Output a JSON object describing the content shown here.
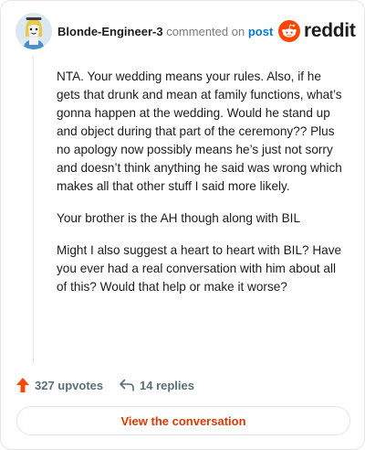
{
  "comment": {
    "author": "Blonde-Engineer-3",
    "action_text": "commented on",
    "post_link": "post",
    "paragraphs": [
      "NTA. Your wedding means your rules. Also, if he gets that drunk and mean at family functions, what’s gonna happen at the wedding. Would he stand up and object during that part of the ceremony?? Plus no apology now possibly means he’s just not sorry and doesn’t think anything he said was wrong which makes all that other stuff I said more likely.",
      "Your brother is the AH though along with BIL",
      "Might I also suggest a heart to heart with BIL? Have you ever had a real conversation with him about all of this? Would that help or make it worse?"
    ]
  },
  "brand": {
    "wordmark": "reddit",
    "icon": "reddit-snoo-icon",
    "color": "#ff4500"
  },
  "stats": {
    "upvotes": "327 upvotes",
    "replies": "14 replies",
    "upvote_icon": "upvote-arrow-icon",
    "reply_icon": "reply-arrow-icon",
    "upvote_color": "#ff4500"
  },
  "cta": {
    "label": "View the conversation",
    "color": "#d93a00"
  }
}
